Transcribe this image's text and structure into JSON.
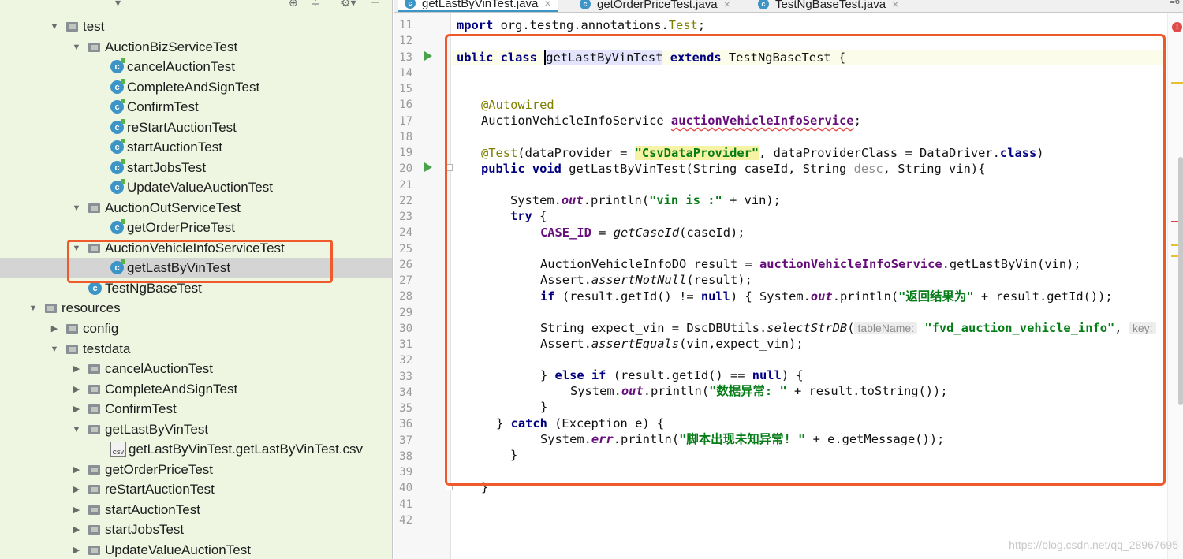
{
  "project_tree": {
    "items": [
      {
        "label": "test",
        "icon": "folder-icon",
        "arrow": "expanded",
        "selected": false
      },
      {
        "label": "AuctionBizServiceTest",
        "icon": "folder-icon",
        "arrow": "expanded",
        "selected": false
      },
      {
        "label": "cancelAuctionTest",
        "icon": "test-class-icon",
        "arrow": "none",
        "selected": false
      },
      {
        "label": "CompleteAndSignTest",
        "icon": "test-class-icon",
        "arrow": "none",
        "selected": false
      },
      {
        "label": "ConfirmTest",
        "icon": "test-class-icon",
        "arrow": "none",
        "selected": false
      },
      {
        "label": "reStartAuctionTest",
        "icon": "test-class-icon",
        "arrow": "none",
        "selected": false
      },
      {
        "label": "startAuctionTest",
        "icon": "test-class-icon",
        "arrow": "none",
        "selected": false
      },
      {
        "label": "startJobsTest",
        "icon": "test-class-icon",
        "arrow": "none",
        "selected": false
      },
      {
        "label": "UpdateValueAuctionTest",
        "icon": "test-class-icon",
        "arrow": "none",
        "selected": false
      },
      {
        "label": "AuctionOutServiceTest",
        "icon": "folder-icon",
        "arrow": "expanded",
        "selected": false
      },
      {
        "label": "getOrderPriceTest",
        "icon": "test-class-icon",
        "arrow": "none",
        "selected": false
      },
      {
        "label": "AuctionVehicleInfoServiceTest",
        "icon": "folder-icon",
        "arrow": "expanded",
        "selected": false
      },
      {
        "label": "getLastByVinTest",
        "icon": "test-class-icon",
        "arrow": "none",
        "selected": true
      },
      {
        "label": "TestNgBaseTest",
        "icon": "class-icon",
        "arrow": "none",
        "selected": false
      },
      {
        "label": "resources",
        "icon": "folder-icon",
        "arrow": "expanded",
        "selected": false
      },
      {
        "label": "config",
        "icon": "folder-icon",
        "arrow": "collapsed",
        "selected": false
      },
      {
        "label": "testdata",
        "icon": "folder-icon",
        "arrow": "expanded",
        "selected": false
      },
      {
        "label": "cancelAuctionTest",
        "icon": "folder-icon",
        "arrow": "collapsed",
        "selected": false
      },
      {
        "label": "CompleteAndSignTest",
        "icon": "folder-icon",
        "arrow": "collapsed",
        "selected": false
      },
      {
        "label": "ConfirmTest",
        "icon": "folder-icon",
        "arrow": "collapsed",
        "selected": false
      },
      {
        "label": "getLastByVinTest",
        "icon": "folder-icon",
        "arrow": "expanded",
        "selected": false
      },
      {
        "label": "getLastByVinTest.getLastByVinTest.csv",
        "icon": "csv-file-icon",
        "arrow": "none",
        "selected": false
      },
      {
        "label": "getOrderPriceTest",
        "icon": "folder-icon",
        "arrow": "collapsed",
        "selected": false
      },
      {
        "label": "reStartAuctionTest",
        "icon": "folder-icon",
        "arrow": "collapsed",
        "selected": false
      },
      {
        "label": "startAuctionTest",
        "icon": "folder-icon",
        "arrow": "collapsed",
        "selected": false
      },
      {
        "label": "startJobsTest",
        "icon": "folder-icon",
        "arrow": "collapsed",
        "selected": false
      },
      {
        "label": "UpdateValueAuctionTest",
        "icon": "folder-icon",
        "arrow": "collapsed",
        "selected": false
      }
    ],
    "class_icon_letter": "c",
    "csv_icon_text": "CSV"
  },
  "tabs": [
    {
      "label": "getLastByVinTest.java",
      "active": true
    },
    {
      "label": "getOrderPriceTest.java",
      "active": false
    },
    {
      "label": "TestNgBaseTest.java",
      "active": false
    }
  ],
  "tab_icon_letter": "c",
  "tab_close_glyph": "×",
  "tabs_overflow_label": "≡6",
  "editor": {
    "line_numbers": [
      "11",
      "12",
      "13",
      "14",
      "15",
      "16",
      "17",
      "18",
      "19",
      "20",
      "21",
      "22",
      "23",
      "24",
      "25",
      "26",
      "27",
      "28",
      "29",
      "30",
      "31",
      "32",
      "33",
      "34",
      "35",
      "36",
      "37",
      "38",
      "39",
      "40",
      "41",
      "42"
    ],
    "run_markers_lines": [
      "13",
      "20"
    ],
    "error_badge": "!",
    "code": {
      "l11_kw": "mport",
      "l11_rest": " org.testng.annotations.",
      "l11_ann": "Test",
      "l11_end": ";",
      "l13_kw1": "ublic class ",
      "l13_name": "getLastByVinTest",
      "l13_kw2": " extends ",
      "l13_rest": "TestNgBaseTest {",
      "l16_ann": "@Autowired",
      "l17_type": "AuctionVehicleInfoService ",
      "l17_field": "auctionVehicleInfoService",
      "l17_end": ";",
      "l19_ann": "@Test",
      "l19_a": "(dataProvider = ",
      "l19_str": "\"CsvDataProvider\"",
      "l19_b": ", dataProviderClass = DataDriver.",
      "l19_kw": "class",
      "l19_c": ")",
      "l20_kw": "public void ",
      "l20_a": "getLastByVinTest(String caseId, String ",
      "l20_gray": "desc",
      "l20_b": ", String vin){",
      "l22_a": "System.",
      "l22_out": "out",
      "l22_b": ".println(",
      "l22_str": "\"vin is :\"",
      "l22_c": " + vin);",
      "l23_kw": "try",
      "l23_a": " {",
      "l24_fld": "CASE_ID",
      "l24_a": " = ",
      "l24_ita": "getCaseId",
      "l24_b": "(caseId);",
      "l26_a": "AuctionVehicleInfoDO result = ",
      "l26_fld": "auctionVehicleInfoService",
      "l26_b": ".getLastByVin(vin);",
      "l27_a": "Assert.",
      "l27_ita": "assertNotNull",
      "l27_b": "(result);",
      "l28_kw": "if",
      "l28_a": " (result.getId() != ",
      "l28_kw2": "null",
      "l28_b": ") { System.",
      "l28_out": "out",
      "l28_c": ".println(",
      "l28_str": "\"返回结果为\"",
      "l28_d": " + result.getId());",
      "l30_a": "String expect_vin = DscDBUtils.",
      "l30_ita": "selectStrDB",
      "l30_b": "(",
      "l30_hint": "tableName:",
      "l30_str": "\"fvd_auction_vehicle_info\"",
      "l30_c": ", ",
      "l30_hint2": "key:",
      "l30_d": " \"",
      "l31_a": "Assert.",
      "l31_ita": "assertEquals",
      "l31_b": "(vin,expect_vin);",
      "l33_a": "} ",
      "l33_kw": "else if",
      "l33_b": " (result.getId() == ",
      "l33_kw2": "null",
      "l33_c": ") {",
      "l34_a": "System.",
      "l34_out": "out",
      "l34_b": ".println(",
      "l34_str": "\"数据异常: \"",
      "l34_c": " + result.toString());",
      "l35_a": "}",
      "l36_a": "} ",
      "l36_kw": "catch",
      "l36_b": " (Exception e) {",
      "l37_a": "System.",
      "l37_err": "err",
      "l37_b": ".println(",
      "l37_str": "\"脚本出现未知异常! \"",
      "l37_c": " + e.getMessage());",
      "l38_a": "}",
      "l40_a": "}"
    }
  },
  "watermark": "https://blog.csdn.net/qq_28967695",
  "colors": {
    "tree_bg": "#eef6e1",
    "highlight_box": "#ee5a2c",
    "keyword": "#000080",
    "string": "#067d17",
    "annotation": "#808000",
    "field": "#660e7a"
  }
}
